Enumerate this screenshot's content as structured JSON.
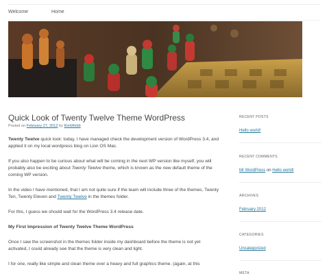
{
  "nav": {
    "items": [
      {
        "label": "Welcome"
      },
      {
        "label": "Home"
      }
    ]
  },
  "post": {
    "title": "Quick Look of Twenty Twelve Theme WordPress",
    "meta": {
      "posted_on": "Posted on",
      "date": "February 27, 2012",
      "by": "by",
      "author": "KimWebb"
    },
    "paragraphs": {
      "p1": {
        "bold": "Twenty Twelve",
        "text": " quick look: today, I have managed check the development version of WordPress 3.4, and applied it on my local wordpress blog on Lion OS Mac."
      },
      "p2": {
        "start": "If you also happen to be curious about what will be coming in the next WP version like myself, you will probably also be exciting about ",
        "italic": "Twenty Twelve",
        "end": " theme, which is known as the new default theme of the coming WP version."
      },
      "p3": {
        "start": "In the video I have mentioned, that I am not quite sure if the team will include three of the themes, Twenty Ten, Twenty Eleven and ",
        "link": "Twenty Twelve",
        "end": " in the themes folder."
      },
      "p4": "For this, I guess we should wait for the WordPress 3.4 release date.",
      "h3": "My First Impression of Twenty Twelve Theme WordPress",
      "p5": "Once I saw the screenshot in the themes folder inside my dashboard before the theme is not yet activated, I could already see that the theme is very clean and light.",
      "p6": "I for one, really like simple and clean theme over a heavy and full graphics theme. (again, at this"
    }
  },
  "sidebar": {
    "recent_posts": {
      "title": "RECENT POSTS",
      "link": "Hello world!"
    },
    "recent_comments": {
      "title": "RECENT COMMENTS",
      "author": "Mr WordPress",
      "on": " on ",
      "link": "Hello world!"
    },
    "archives": {
      "title": "ARCHIVES",
      "link": "February 2012"
    },
    "categories": {
      "title": "CATEGORIES",
      "link": "Uncategorized"
    },
    "meta": {
      "title": "META"
    }
  },
  "colors": {
    "link": "#21759b",
    "text": "#444444",
    "rule": "#ededed"
  }
}
